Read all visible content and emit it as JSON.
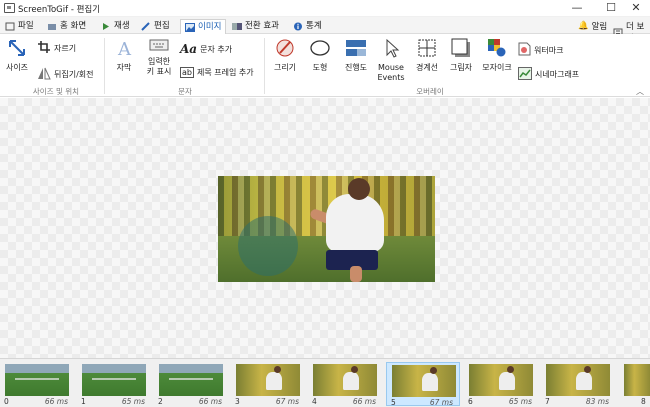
{
  "window": {
    "title": "ScreenToGif - 편집기"
  },
  "tabs": [
    {
      "label": "파일"
    },
    {
      "label": "홈 화면"
    },
    {
      "label": "재생"
    },
    {
      "label": "편집"
    },
    {
      "label": "이미지"
    },
    {
      "label": "전환 효과"
    },
    {
      "label": "통계"
    }
  ],
  "tabs_right": {
    "alerts": "알림",
    "more": "더 보기"
  },
  "ribbon": {
    "size": {
      "resize": "사이즈",
      "crop": "자르기",
      "flip": "뒤집기/회전",
      "group": "사이즈 및 위치"
    },
    "text": {
      "caption": "자막",
      "keystrokes": [
        "입력한",
        "키 표시"
      ],
      "free_text": "문자 추가",
      "title_frame": "제목 프레임 추가",
      "group": "문자"
    },
    "overlay": {
      "draw": "그리기",
      "shapes": "도형",
      "progress": "진행도",
      "mouse_events": [
        "Mouse",
        "Events"
      ],
      "border": "경계선",
      "shadow": "그림자",
      "obfuscate": "모자이크",
      "watermark": "워터마크",
      "cinemagraph": "시네마그래프",
      "group": "오버레이"
    }
  },
  "frames": [
    {
      "index": "0",
      "delay": "66 ms",
      "kind": "field"
    },
    {
      "index": "1",
      "delay": "65 ms",
      "kind": "field"
    },
    {
      "index": "2",
      "delay": "66 ms",
      "kind": "field"
    },
    {
      "index": "3",
      "delay": "67 ms",
      "kind": "close"
    },
    {
      "index": "4",
      "delay": "66 ms",
      "kind": "close"
    },
    {
      "index": "5",
      "delay": "67 ms",
      "kind": "close",
      "selected": true
    },
    {
      "index": "6",
      "delay": "65 ms",
      "kind": "close"
    },
    {
      "index": "7",
      "delay": "83 ms",
      "kind": "close"
    },
    {
      "index": "8",
      "delay": "",
      "kind": "close"
    }
  ]
}
